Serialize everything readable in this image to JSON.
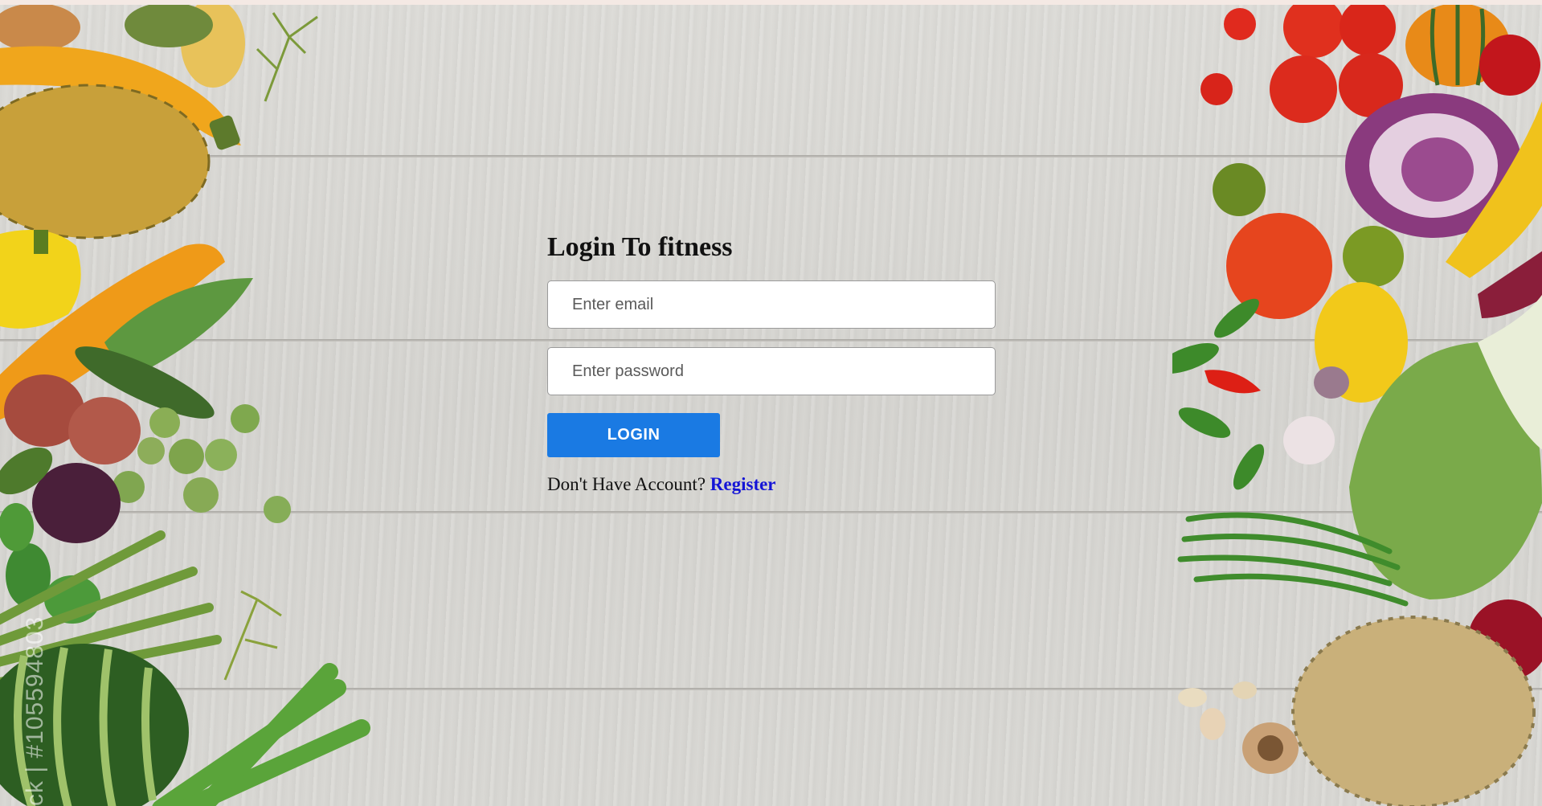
{
  "login": {
    "title": "Login To fitness",
    "email_placeholder": "Enter email",
    "password_placeholder": "Enter password",
    "button_label": "LOGIN",
    "register_prompt": "Don't Have Account? ",
    "register_link": "Register"
  },
  "background": {
    "watermark": "ck | #105594803"
  },
  "colors": {
    "button": "#1a7ae3",
    "link": "#1414d6",
    "wood": "#d9d8d4"
  }
}
